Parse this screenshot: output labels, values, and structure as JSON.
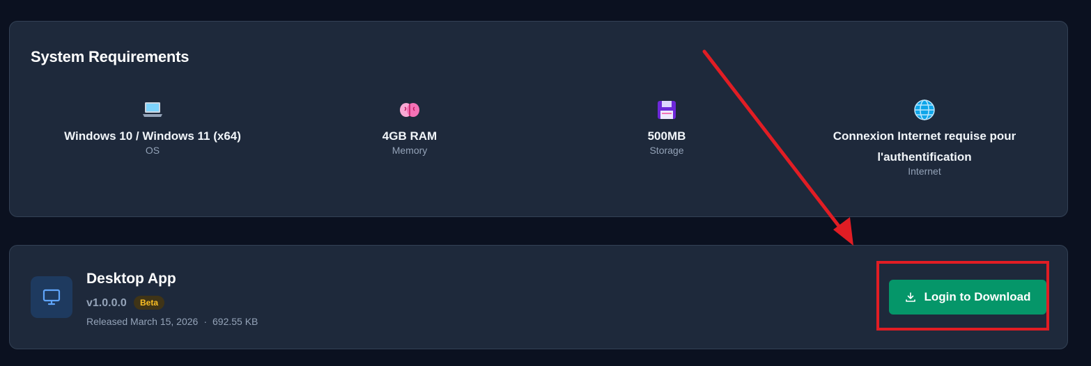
{
  "requirements": {
    "title": "System Requirements",
    "items": [
      {
        "icon": "laptop-icon",
        "value": "Windows 10 / Windows 11 (x64)",
        "label": "OS"
      },
      {
        "icon": "brain-icon",
        "value": "4GB RAM",
        "label": "Memory"
      },
      {
        "icon": "floppy-disk-icon",
        "value": "500MB",
        "label": "Storage"
      },
      {
        "icon": "globe-icon",
        "value": "Connexion Internet requise pour l'authentification",
        "label": "Internet"
      }
    ]
  },
  "app": {
    "icon": "monitor-icon",
    "title": "Desktop App",
    "version": "v1.0.0.0",
    "badge": "Beta",
    "released": "Released March 15, 2026",
    "separator": "·",
    "size": "692.55 KB",
    "download_label": "Login to Download",
    "download_icon": "download-icon"
  },
  "colors": {
    "background": "#0b1120",
    "card": "#1e293b",
    "accent_green": "#059669",
    "badge_text": "#fbbf24",
    "annotation_red": "#e11d24"
  }
}
